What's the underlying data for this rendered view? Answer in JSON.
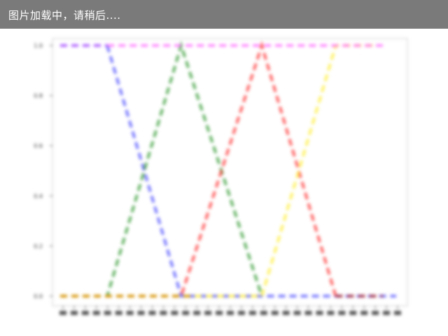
{
  "loading_message": "图片加载中，请稍后....",
  "chart_data": {
    "type": "line",
    "title": "",
    "xlabel": "",
    "ylabel": "",
    "grid": false,
    "ylim": [
      0.0,
      1.0
    ],
    "xlim": [
      0,
      50
    ],
    "y_ticks": [
      "0.0",
      "0.2",
      "0.4",
      "0.6",
      "0.8",
      "1.0"
    ],
    "x_tick_count": 31,
    "line_style": "dashed",
    "series": [
      {
        "color": "#9933ff",
        "x": [
          0,
          7
        ],
        "y": [
          1.0,
          1.0
        ]
      },
      {
        "color": "#4d4dff",
        "x": [
          7,
          18,
          20,
          50
        ],
        "y": [
          1.0,
          0.0,
          0.0,
          0.0
        ]
      },
      {
        "color": "#339933",
        "x": [
          0,
          7,
          18,
          30
        ],
        "y": [
          0.0,
          0.0,
          1.0,
          0.0
        ]
      },
      {
        "color": "#ff3333",
        "x": [
          0,
          18,
          30,
          41
        ],
        "y": [
          0.0,
          0.0,
          1.0,
          0.0
        ]
      },
      {
        "color": "#ffee33",
        "x": [
          0,
          30,
          41,
          47
        ],
        "y": [
          0.0,
          0.0,
          1.0,
          1.0
        ]
      },
      {
        "color": "#ff66ff",
        "x": [
          7,
          48
        ],
        "y": [
          1.0,
          1.0
        ]
      },
      {
        "color": "#cc8800",
        "x": [
          0,
          20
        ],
        "y": [
          0.0,
          0.0
        ]
      },
      {
        "color": "#aa2222",
        "x": [
          41,
          48
        ],
        "y": [
          0.0,
          0.0
        ]
      }
    ]
  }
}
